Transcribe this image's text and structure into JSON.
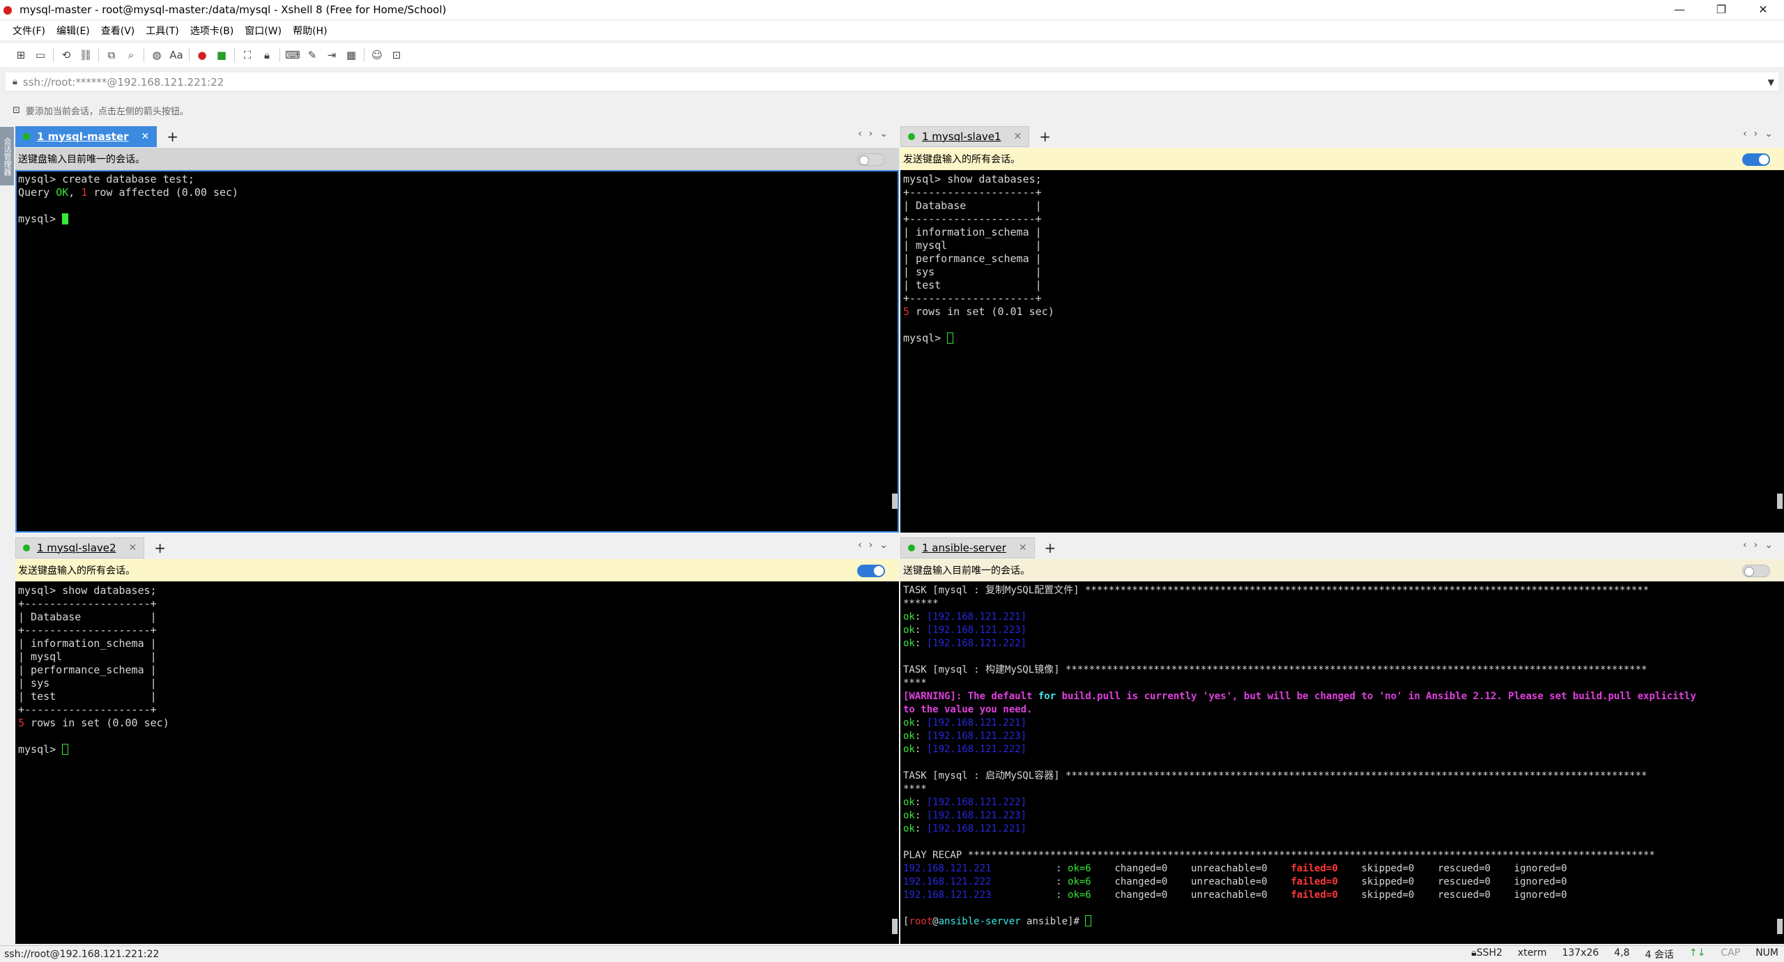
{
  "window": {
    "title": "mysql-master - root@mysql-master:/data/mysql - Xshell 8 (Free for Home/School)",
    "minimize": "—",
    "maximize": "❐",
    "close": "✕"
  },
  "menu": [
    "文件(F)",
    "编辑(E)",
    "查看(V)",
    "工具(T)",
    "选项卡(B)",
    "窗口(W)",
    "帮助(H)"
  ],
  "address": {
    "value": "ssh://root:******@192.168.121.221:22"
  },
  "hint": "要添加当前会话，点击左侧的箭头按钮。",
  "side_tab": "会话管理器",
  "panes": {
    "master": {
      "tab": "1 mysql-master",
      "send_text": "送键盘输入目前唯一的会话。",
      "lines": [
        "mysql> create database test;"
      ],
      "query_ok_prefix": "Query ",
      "query_ok": "OK",
      "query_ok_mid": ", ",
      "query_ok_num": "1",
      "query_ok_rest": " row affected (0.00 sec)",
      "prompt": "mysql> "
    },
    "slave1": {
      "tab": "1 mysql-slave1",
      "send_text": "发送键盘输入的所有会话。",
      "lines": [
        "mysql> show databases;",
        "+--------------------+",
        "| Database           |",
        "+--------------------+",
        "| information_schema |",
        "| mysql              |",
        "| performance_schema |",
        "| sys                |",
        "| test               |",
        "+--------------------+"
      ],
      "rows_num": "5",
      "rows_rest": " rows in set (0.01 sec)",
      "prompt": "mysql> "
    },
    "slave2": {
      "tab": "1 mysql-slave2",
      "send_text": "发送键盘输入的所有会话。",
      "lines": [
        "mysql> show databases;",
        "+--------------------+",
        "| Database           |",
        "+--------------------+",
        "| information_schema |",
        "| mysql              |",
        "| performance_schema |",
        "| sys                |",
        "| test               |",
        "+--------------------+"
      ],
      "rows_num": "5",
      "rows_rest": " rows in set (0.00 sec)",
      "prompt": "mysql> "
    },
    "ansible": {
      "tab": "1 ansible-server",
      "send_text": "送键盘输入目前唯一的会话。",
      "task1": "TASK [mysql : 复制MySQL配置文件] ************************************************************************************************",
      "task1_wrap": "******",
      "task1_hosts": [
        "[192.168.121.221]",
        "[192.168.121.223]",
        "[192.168.121.222]"
      ],
      "task2": "TASK [mysql : 构建MySQL镜像] ***************************************************************************************************",
      "task2_wrap": "****",
      "warning_tag": "[WARNING]",
      "warning_1": ": The default ",
      "warning_for": "for",
      "warning_2": " build.pull is currently 'yes', but will be changed to 'no' in Ansible 2.12. Please set build.pull explicitly",
      "warning_3": "to the value you need.",
      "task2_hosts": [
        "[192.168.121.221]",
        "[192.168.121.223]",
        "[192.168.121.222]"
      ],
      "task3": "TASK [mysql : 启动MySQL容器] ***************************************************************************************************",
      "task3_wrap": "****",
      "task3_hosts": [
        "[192.168.121.222]",
        "[192.168.121.223]",
        "[192.168.121.221]"
      ],
      "ok": "ok",
      "recap": "PLAY RECAP *********************************************************************************************************************",
      "recap_rows": [
        {
          "host": "192.168.121.221",
          "ok": "ok=6",
          "changed": "changed=0",
          "unreachable": "unreachable=0",
          "failed": "failed=0",
          "skipped": "skipped=0",
          "rescued": "rescued=0",
          "ignored": "ignored=0"
        },
        {
          "host": "192.168.121.222",
          "ok": "ok=6",
          "changed": "changed=0",
          "unreachable": "unreachable=0",
          "failed": "failed=0",
          "skipped": "skipped=0",
          "rescued": "rescued=0",
          "ignored": "ignored=0"
        },
        {
          "host": "192.168.121.223",
          "ok": "ok=6",
          "changed": "changed=0",
          "unreachable": "unreachable=0",
          "failed": "failed=0",
          "skipped": "skipped=0",
          "rescued": "rescued=0",
          "ignored": "ignored=0"
        }
      ],
      "prompt_open": "[",
      "prompt_user": "root",
      "prompt_at": "@",
      "prompt_host": "ansible-server",
      "prompt_rest": " ansible]# "
    }
  },
  "status": {
    "left": "ssh://root@192.168.121.221:22",
    "protocol": "SSH2",
    "term": "xterm",
    "size": "137x26",
    "pos": "4,8",
    "sessions": "4 会话",
    "cap": "CAP",
    "num": "NUM"
  },
  "colors": {
    "accent": "#3c8ae0",
    "send_bar_yellow": "#fdf6c8",
    "terminal_bg": "#000000",
    "ok_green": "#39e639",
    "fail_red": "#ff3838"
  },
  "icons": [
    "app-logo-icon",
    "new-session-icon",
    "open-folder-icon",
    "reconnect-icon",
    "link-icon",
    "new-window-icon",
    "search-icon",
    "globe-icon",
    "font-icon",
    "xftp-icon",
    "xmanager-icon",
    "fullscreen-icon",
    "lock-icon",
    "compose-icon",
    "script-icon",
    "tunnel-icon",
    "layout-icon",
    "chat-icon",
    "toggle-tool-icon"
  ]
}
